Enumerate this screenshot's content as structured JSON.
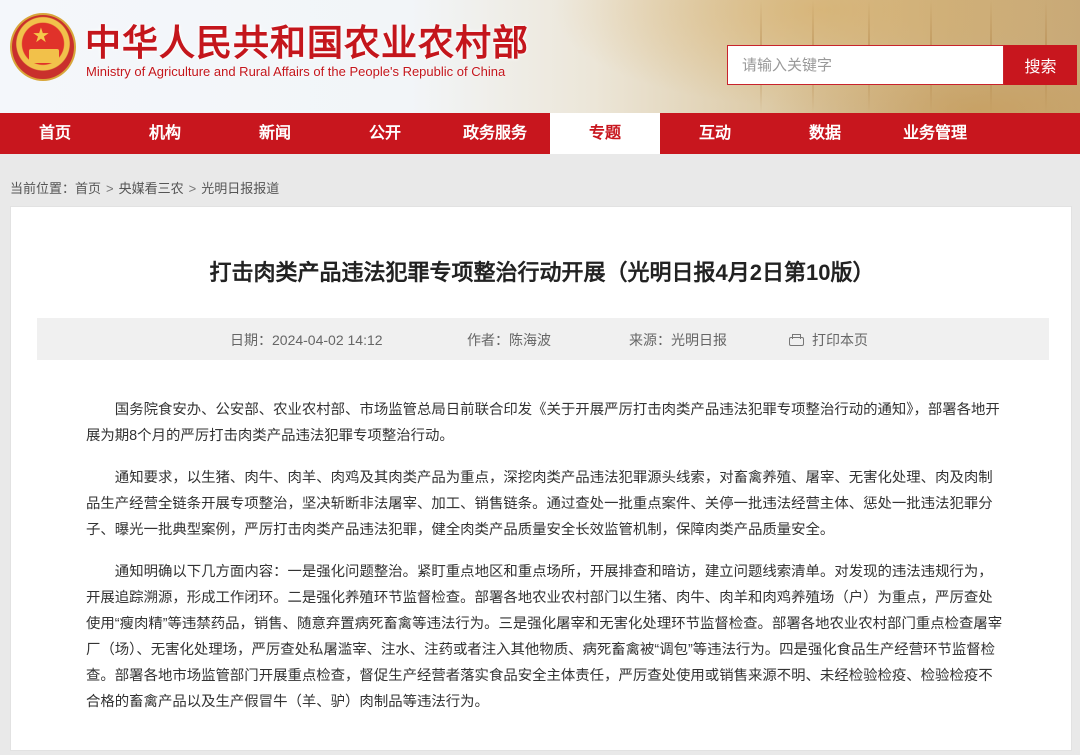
{
  "header": {
    "title_cn": "中华人民共和国农业农村部",
    "title_en": "Ministry of Agriculture and Rural Affairs of the People's Republic of China",
    "emblem_icon": "national-emblem-icon",
    "search_placeholder": "请输入关键字",
    "search_button": "搜索",
    "brand_color": "#c8161e"
  },
  "nav": {
    "items": [
      {
        "label": "首页"
      },
      {
        "label": "机构"
      },
      {
        "label": "新闻"
      },
      {
        "label": "公开"
      },
      {
        "label": "政务服务"
      },
      {
        "label": "专题",
        "active": true
      },
      {
        "label": "互动"
      },
      {
        "label": "数据"
      },
      {
        "label": "业务管理"
      }
    ]
  },
  "breadcrumb": {
    "prefix": "当前位置：",
    "items": [
      "首页",
      "央媒看三农",
      "光明日报报道"
    ],
    "separator": ">"
  },
  "article": {
    "title": "打击肉类产品违法犯罪专项整治行动开展（光明日报4月2日第10版）",
    "meta": {
      "date": "日期：2024-04-02 14:12",
      "author": "作者：陈海波",
      "source": "来源：光明日报",
      "print": "打印本页"
    },
    "paragraphs": [
      "国务院食安办、公安部、农业农村部、市场监管总局日前联合印发《关于开展严厉打击肉类产品违法犯罪专项整治行动的通知》，部署各地开展为期8个月的严厉打击肉类产品违法犯罪专项整治行动。",
      "通知要求，以生猪、肉牛、肉羊、肉鸡及其肉类产品为重点，深挖肉类产品违法犯罪源头线索，对畜禽养殖、屠宰、无害化处理、肉及肉制品生产经营全链条开展专项整治，坚决斩断非法屠宰、加工、销售链条。通过查处一批重点案件、关停一批违法经营主体、惩处一批违法犯罪分子、曝光一批典型案例，严厉打击肉类产品违法犯罪，健全肉类产品质量安全长效监管机制，保障肉类产品质量安全。",
      "通知明确以下几方面内容：一是强化问题整治。紧盯重点地区和重点场所，开展排查和暗访，建立问题线索清单。对发现的违法违规行为，开展追踪溯源，形成工作闭环。二是强化养殖环节监督检查。部署各地农业农村部门以生猪、肉牛、肉羊和肉鸡养殖场（户）为重点，严厉查处使用“瘦肉精”等违禁药品，销售、随意弃置病死畜禽等违法行为。三是强化屠宰和无害化处理环节监督检查。部署各地农业农村部门重点检查屠宰厂（场）、无害化处理场，严厉查处私屠滥宰、注水、注药或者注入其他物质、病死畜禽被“调包”等违法行为。四是强化食品生产经营环节监督检查。部署各地市场监管部门开展重点检查，督促生产经营者落实食品安全主体责任，严厉查处使用或销售来源不明、未经检验检疫、检验检疫不合格的畜禽产品以及生产假冒牛（羊、驴）肉制品等违法行为。"
    ]
  }
}
